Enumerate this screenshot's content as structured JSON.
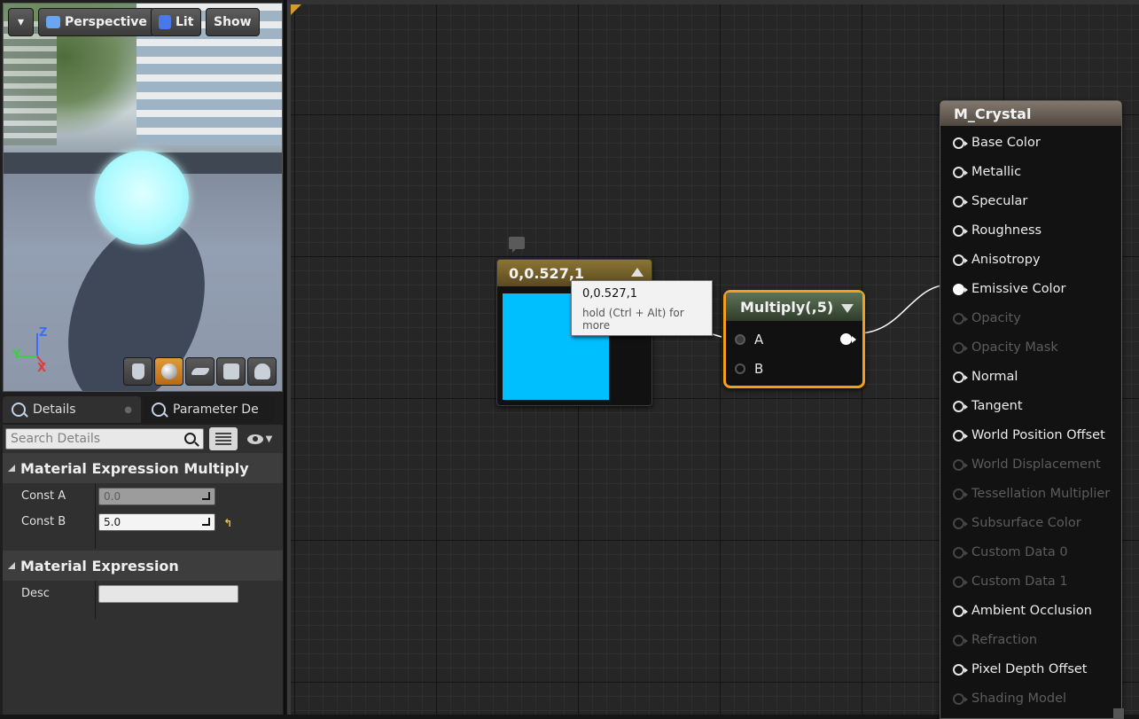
{
  "viewport": {
    "menu_button": "▾",
    "perspective_label": "Perspective",
    "lit_label": "Lit",
    "show_label": "Show",
    "axis_z": "Z",
    "axis_y": "Y",
    "axis_x": "X",
    "preview_tools": [
      "cylinder-icon",
      "sphere-icon",
      "plane-icon",
      "cube-icon",
      "teapot-icon"
    ],
    "active_preview_tool": "sphere-icon"
  },
  "tabs": [
    {
      "label": "Details",
      "active": true
    },
    {
      "label": "Parameter De",
      "active": false
    }
  ],
  "details": {
    "search_placeholder": "Search Details",
    "sections": [
      {
        "title": "Material Expression Multiply",
        "properties": [
          {
            "label": "Const A",
            "value": "0.0",
            "enabled": false
          },
          {
            "label": "Const B",
            "value": "5.0",
            "enabled": true
          }
        ]
      },
      {
        "title": "Material Expression",
        "properties": [
          {
            "label": "Desc",
            "value": ""
          }
        ]
      }
    ]
  },
  "graph": {
    "constant_node": {
      "title": "0,0.527,1",
      "swatch_color": "#00bfff"
    },
    "tooltip": {
      "main": "0,0.527,1",
      "hint": "hold (Ctrl + Alt) for more"
    },
    "multiply_node": {
      "title": "Multiply(,5)",
      "inputs": [
        "A",
        "B"
      ]
    },
    "material_node": {
      "title": "M_Crystal",
      "pins": [
        {
          "label": "Base Color",
          "enabled": true
        },
        {
          "label": "Metallic",
          "enabled": true
        },
        {
          "label": "Specular",
          "enabled": true
        },
        {
          "label": "Roughness",
          "enabled": true
        },
        {
          "label": "Anisotropy",
          "enabled": true
        },
        {
          "label": "Emissive Color",
          "enabled": true,
          "connected": true
        },
        {
          "label": "Opacity",
          "enabled": false
        },
        {
          "label": "Opacity Mask",
          "enabled": false
        },
        {
          "label": "Normal",
          "enabled": true
        },
        {
          "label": "Tangent",
          "enabled": true
        },
        {
          "label": "World Position Offset",
          "enabled": true
        },
        {
          "label": "World Displacement",
          "enabled": false
        },
        {
          "label": "Tessellation Multiplier",
          "enabled": false
        },
        {
          "label": "Subsurface Color",
          "enabled": false
        },
        {
          "label": "Custom Data 0",
          "enabled": false
        },
        {
          "label": "Custom Data 1",
          "enabled": false
        },
        {
          "label": "Ambient Occlusion",
          "enabled": true
        },
        {
          "label": "Refraction",
          "enabled": false
        },
        {
          "label": "Pixel Depth Offset",
          "enabled": true
        },
        {
          "label": "Shading Model",
          "enabled": false
        }
      ]
    }
  }
}
